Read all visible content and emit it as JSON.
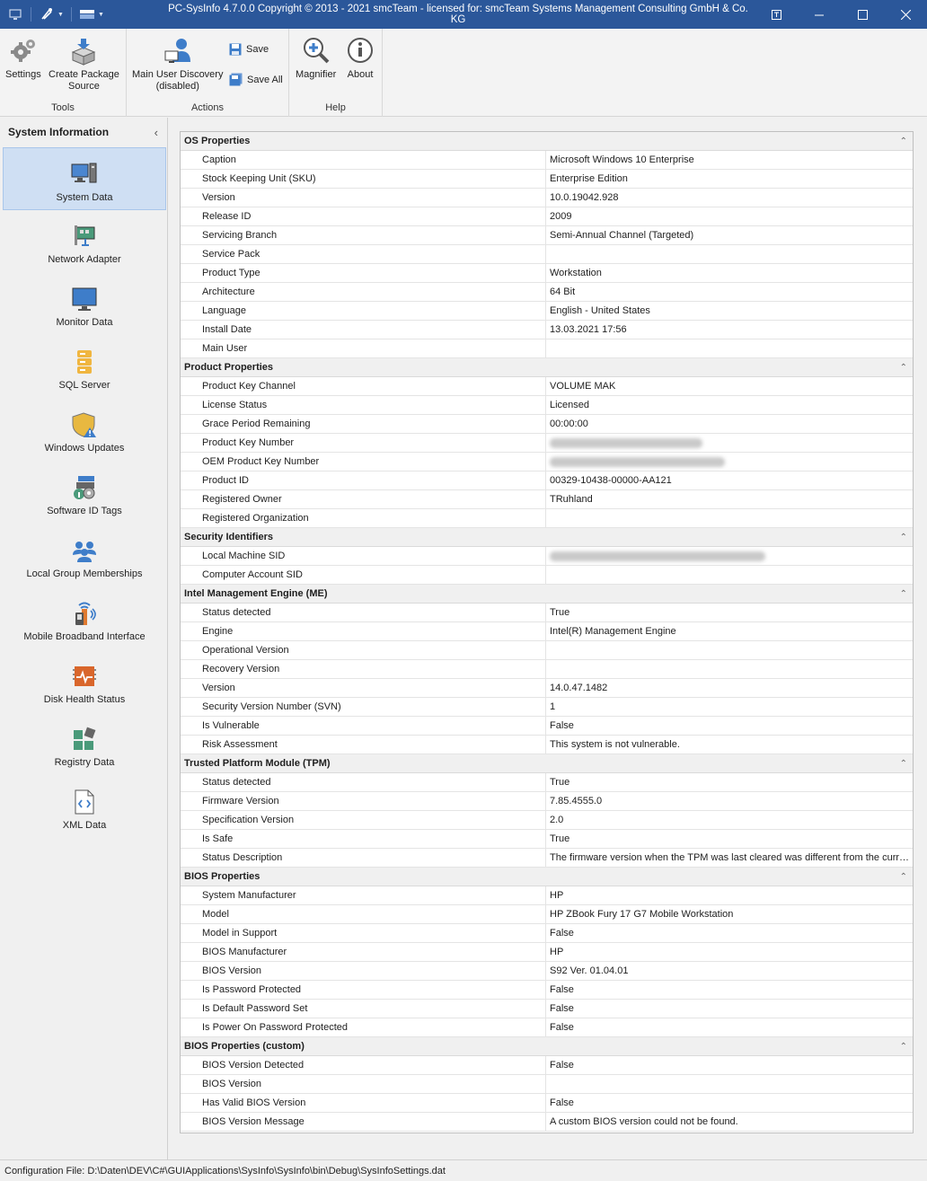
{
  "titlebar": {
    "title": "PC-SysInfo 4.7.0.0 Copyright © 2013 - 2021 smcTeam - licensed for: smcTeam Systems Management Consulting GmbH & Co. KG"
  },
  "ribbon": {
    "groups": {
      "tools": "Tools",
      "actions": "Actions",
      "help": "Help"
    },
    "settings": "Settings",
    "create_package_1": "Create Package",
    "create_package_2": "Source",
    "main_user_1": "Main User Discovery",
    "main_user_2": "(disabled)",
    "save": "Save",
    "save_all": "Save All",
    "magnifier": "Magnifier",
    "about": "About"
  },
  "sidebar": {
    "header": "System Information",
    "items": [
      {
        "label": "System Data",
        "icon": "computer-icon"
      },
      {
        "label": "Network Adapter",
        "icon": "network-card-icon"
      },
      {
        "label": "Monitor Data",
        "icon": "monitor-icon"
      },
      {
        "label": "SQL Server",
        "icon": "database-icon"
      },
      {
        "label": "Windows Updates",
        "icon": "shield-warning-icon"
      },
      {
        "label": "Software ID Tags",
        "icon": "tags-icon"
      },
      {
        "label": "Local Group Memberships",
        "icon": "users-icon"
      },
      {
        "label": "Mobile Broadband Interface",
        "icon": "signal-icon"
      },
      {
        "label": "Disk Health Status",
        "icon": "disk-health-icon"
      },
      {
        "label": "Registry Data",
        "icon": "registry-icon"
      },
      {
        "label": "XML Data",
        "icon": "xml-file-icon"
      }
    ]
  },
  "grid": {
    "groups": [
      {
        "title": "OS Properties",
        "rows": [
          {
            "name": "Caption",
            "value": "Microsoft Windows 10 Enterprise"
          },
          {
            "name": "Stock Keeping Unit (SKU)",
            "value": "Enterprise Edition"
          },
          {
            "name": "Version",
            "value": "10.0.19042.928"
          },
          {
            "name": "Release ID",
            "value": "2009"
          },
          {
            "name": "Servicing Branch",
            "value": "Semi-Annual Channel (Targeted)"
          },
          {
            "name": "Service Pack",
            "value": ""
          },
          {
            "name": "Product Type",
            "value": "Workstation"
          },
          {
            "name": "Architecture",
            "value": "64 Bit"
          },
          {
            "name": "Language",
            "value": "English - United States"
          },
          {
            "name": "Install Date",
            "value": "13.03.2021 17:56"
          },
          {
            "name": "Main User",
            "value": ""
          }
        ]
      },
      {
        "title": "Product Properties",
        "rows": [
          {
            "name": "Product Key Channel",
            "value": "VOLUME MAK"
          },
          {
            "name": "License Status",
            "value": "Licensed"
          },
          {
            "name": "Grace Period Remaining",
            "value": "00:00:00"
          },
          {
            "name": "Product Key Number",
            "value": "",
            "blurred": true
          },
          {
            "name": "OEM Product Key Number",
            "value": "",
            "blurred": true
          },
          {
            "name": "Product ID",
            "value": "00329-10438-00000-AA121"
          },
          {
            "name": "Registered Owner",
            "value": "TRuhland"
          },
          {
            "name": "Registered Organization",
            "value": ""
          }
        ]
      },
      {
        "title": "Security Identifiers",
        "rows": [
          {
            "name": "Local Machine SID",
            "value": "",
            "blurred": true
          },
          {
            "name": "Computer Account SID",
            "value": ""
          }
        ]
      },
      {
        "title": "Intel Management Engine (ME)",
        "rows": [
          {
            "name": "Status detected",
            "value": "True"
          },
          {
            "name": "Engine",
            "value": "Intel(R) Management Engine"
          },
          {
            "name": "Operational Version",
            "value": ""
          },
          {
            "name": "Recovery Version",
            "value": ""
          },
          {
            "name": "Version",
            "value": "14.0.47.1482"
          },
          {
            "name": "Security Version Number (SVN)",
            "value": "1"
          },
          {
            "name": "Is Vulnerable",
            "value": "False"
          },
          {
            "name": "Risk Assessment",
            "value": "This system is not vulnerable."
          }
        ]
      },
      {
        "title": "Trusted Platform Module (TPM)",
        "rows": [
          {
            "name": "Status detected",
            "value": "True"
          },
          {
            "name": "Firmware Version",
            "value": "7.85.4555.0"
          },
          {
            "name": "Specification Version",
            "value": "2.0"
          },
          {
            "name": "Is Safe",
            "value": "True"
          },
          {
            "name": "Status Description",
            "value": "The firmware version when the TPM was last cleared was different from the curre..."
          }
        ]
      },
      {
        "title": "BIOS Properties",
        "rows": [
          {
            "name": "System Manufacturer",
            "value": "HP"
          },
          {
            "name": "Model",
            "value": "HP ZBook Fury 17 G7 Mobile Workstation"
          },
          {
            "name": "Model in Support",
            "value": "False"
          },
          {
            "name": "BIOS Manufacturer",
            "value": "HP"
          },
          {
            "name": "BIOS Version",
            "value": "S92 Ver. 01.04.01"
          },
          {
            "name": "Is Password Protected",
            "value": "False"
          },
          {
            "name": "Is Default Password Set",
            "value": "False"
          },
          {
            "name": "Is Power On Password Protected",
            "value": "False"
          }
        ]
      },
      {
        "title": "BIOS Properties (custom)",
        "rows": [
          {
            "name": "BIOS Version Detected",
            "value": "False"
          },
          {
            "name": "BIOS Version",
            "value": ""
          },
          {
            "name": "Has Valid BIOS Version",
            "value": "False"
          },
          {
            "name": "BIOS Version Message",
            "value": "A custom BIOS version could not be found."
          }
        ]
      }
    ]
  },
  "statusbar": {
    "text": "Configuration File: D:\\Daten\\DEV\\C#\\GUIApplications\\SysInfo\\SysInfo\\bin\\Debug\\SysInfoSettings.dat"
  }
}
